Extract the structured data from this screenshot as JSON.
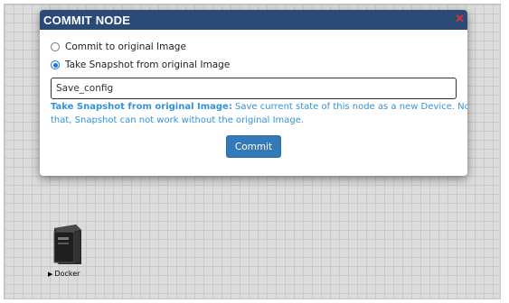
{
  "canvas": {
    "node": {
      "label": "Docker",
      "expand_icon": "triangle-right-icon",
      "icon": "server-tower-icon"
    }
  },
  "dialog": {
    "title": "COMMIT NODE",
    "close_label": "✕",
    "close_icon": "close-icon",
    "options": [
      {
        "label": "Commit to original Image",
        "checked": false
      },
      {
        "label": "Take Snapshot from original Image",
        "checked": true
      }
    ],
    "name_input": {
      "value": "Save_config"
    },
    "note": {
      "title": "Take Snapshot from original Image:",
      "line1": " Save current state of this node as a new Device. Note",
      "line2": "that, Snapshot can not work without the original Image."
    },
    "commit_label": "Commit"
  },
  "colors": {
    "header": "#2c4a78",
    "accent": "#337ab7",
    "note_text": "#3592d6",
    "close": "#e03030"
  }
}
